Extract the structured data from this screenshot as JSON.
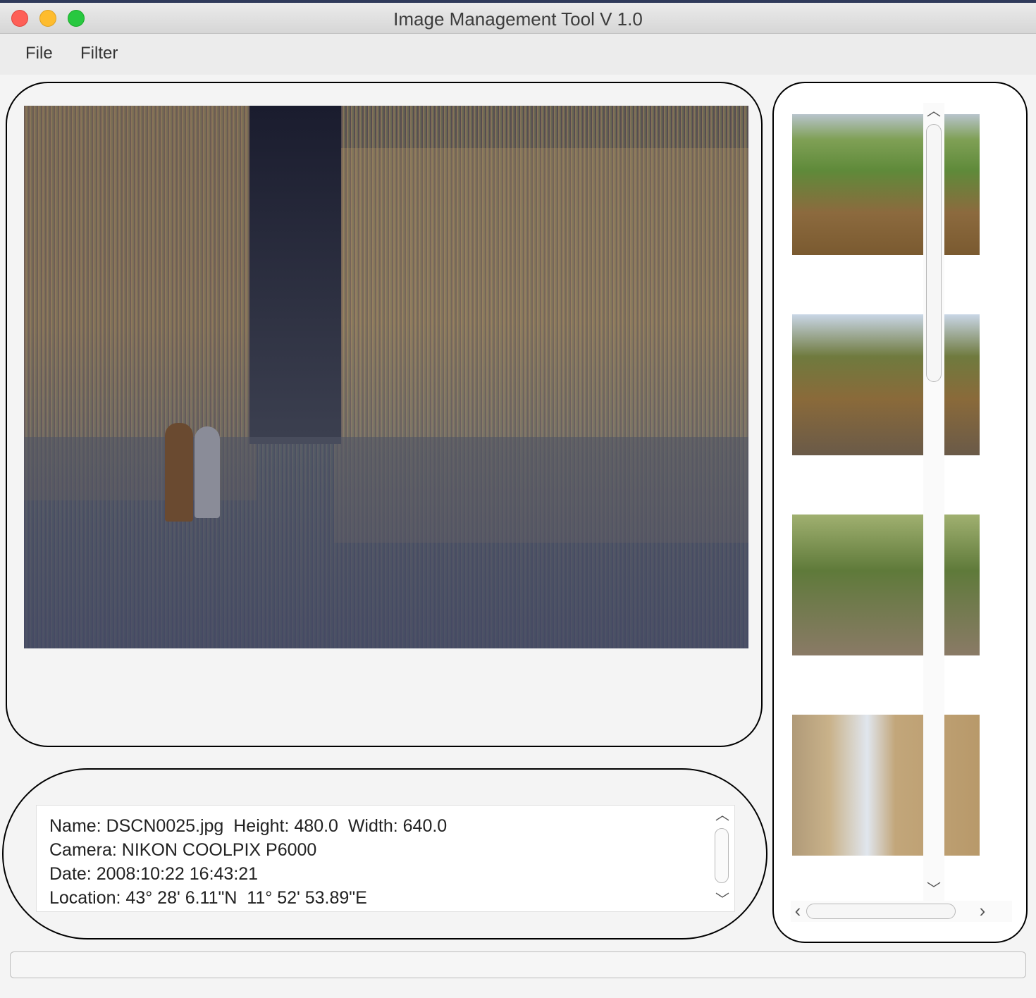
{
  "window": {
    "title": "Image Management Tool V 1.0"
  },
  "menu": {
    "file_label": "File",
    "filter_label": "Filter"
  },
  "info": {
    "lines": [
      "Name: DSCN0025.jpg  Height: 480.0  Width: 640.0",
      "Camera: NIKON COOLPIX P6000",
      "Date: 2008:10:22 16:43:21",
      "Location: 43° 28' 6.11\"N  11° 52' 53.89\"E"
    ]
  },
  "scroll": {
    "up": "︿",
    "down": "﹀",
    "left": "‹",
    "right": "›"
  }
}
